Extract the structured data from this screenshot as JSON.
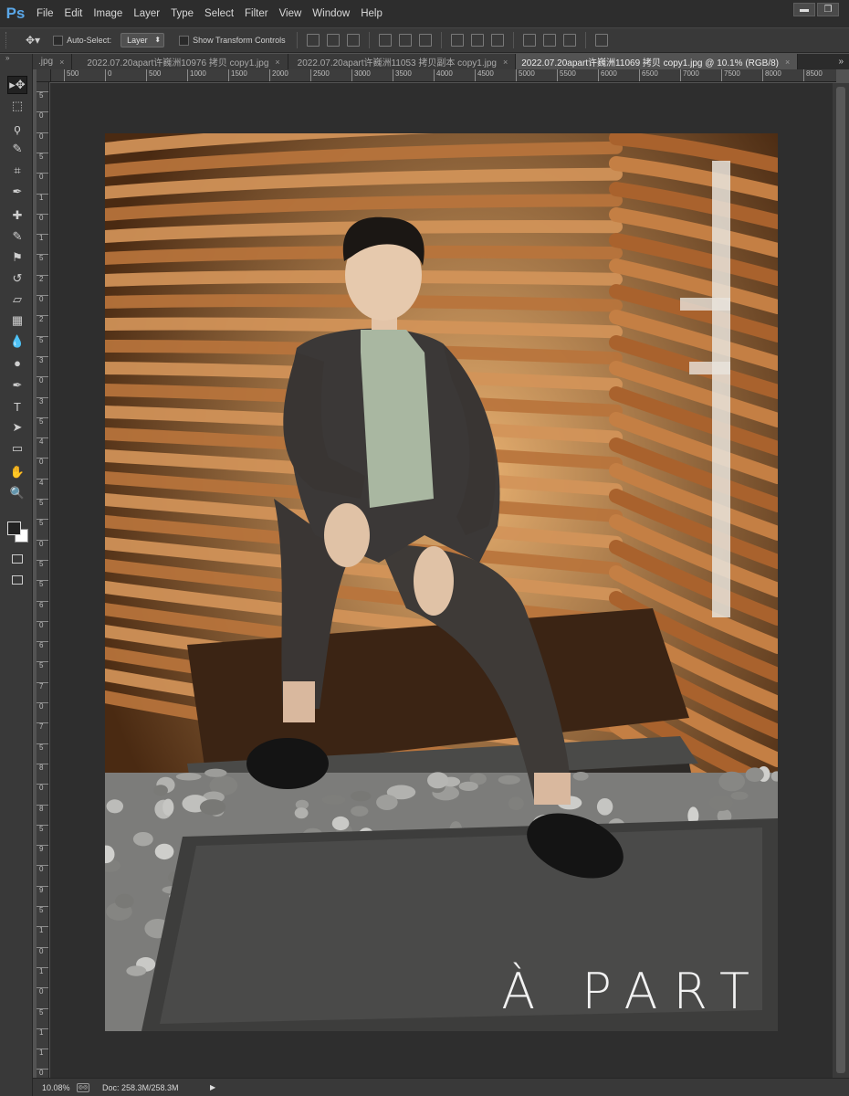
{
  "app": {
    "logo": "Ps"
  },
  "menu": [
    "File",
    "Edit",
    "Image",
    "Layer",
    "Type",
    "Select",
    "Filter",
    "View",
    "Window",
    "Help"
  ],
  "window_controls": {
    "minimize": "▬",
    "restore": "❐"
  },
  "options": {
    "auto_select_label": "Auto-Select:",
    "auto_select_value": "Layer",
    "show_transform_label": "Show Transform Controls"
  },
  "tabs": [
    {
      "label": ".jpg",
      "active": false
    },
    {
      "label": "2022.07.20apart许巍洲10976 拷贝 copy1.jpg",
      "active": false
    },
    {
      "label": "2022.07.20apart许巍洲11053 拷贝副本 copy1.jpg",
      "active": false
    },
    {
      "label": "2022.07.20apart许巍洲11069 拷贝 copy1.jpg @ 10.1% (RGB/8)",
      "active": true
    }
  ],
  "tab_close": "×",
  "tab_overflow": "»",
  "ruler_h": [
    "500",
    "0",
    "500",
    "1000",
    "1500",
    "2000",
    "2500",
    "3000",
    "3500",
    "4000",
    "4500",
    "5000",
    "5500",
    "6000",
    "6500",
    "7000",
    "7500",
    "8000",
    "8500"
  ],
  "ruler_v": [
    "5",
    "0",
    "0",
    "5",
    "0",
    "1",
    "0",
    "1",
    "5",
    "2",
    "0",
    "2",
    "5",
    "3",
    "0",
    "3",
    "5",
    "4",
    "0",
    "4",
    "5",
    "5",
    "0",
    "5",
    "5",
    "6",
    "0",
    "6",
    "5",
    "7",
    "0",
    "7",
    "5",
    "8",
    "0",
    "8",
    "5",
    "9",
    "0",
    "9",
    "5",
    "1",
    "0",
    "1",
    "0",
    "5",
    "1",
    "1",
    "0"
  ],
  "tools": [
    "move-tool",
    "marquee-tool",
    "lasso-tool",
    "quick-select-tool",
    "crop-tool",
    "eyedropper-tool",
    "healing-tool",
    "brush-tool",
    "stamp-tool",
    "history-brush-tool",
    "eraser-tool",
    "gradient-tool",
    "blur-tool",
    "dodge-tool",
    "pen-tool",
    "type-tool",
    "path-select-tool",
    "shape-tool",
    "hand-tool",
    "zoom-tool"
  ],
  "tool_glyphs": [
    "▸✥",
    "⬚",
    "ϙ",
    "✎",
    "⌗",
    "✒",
    "✚",
    "✎",
    "⚑",
    "↺",
    "▱",
    "▦",
    "💧",
    "●",
    "✒",
    "T",
    "➤",
    "▭",
    "✋",
    "🔍"
  ],
  "photo": {
    "watermark": "À PART"
  },
  "status": {
    "zoom": "10.08%",
    "doc": "Doc: 258.3M/258.3M",
    "arrow": "▶"
  },
  "colors": {
    "chrome_dark": "#2d2d2d",
    "panel": "#393939",
    "canvas_bg": "#2e2e2e",
    "accent_ps": "#5aa7e8"
  }
}
